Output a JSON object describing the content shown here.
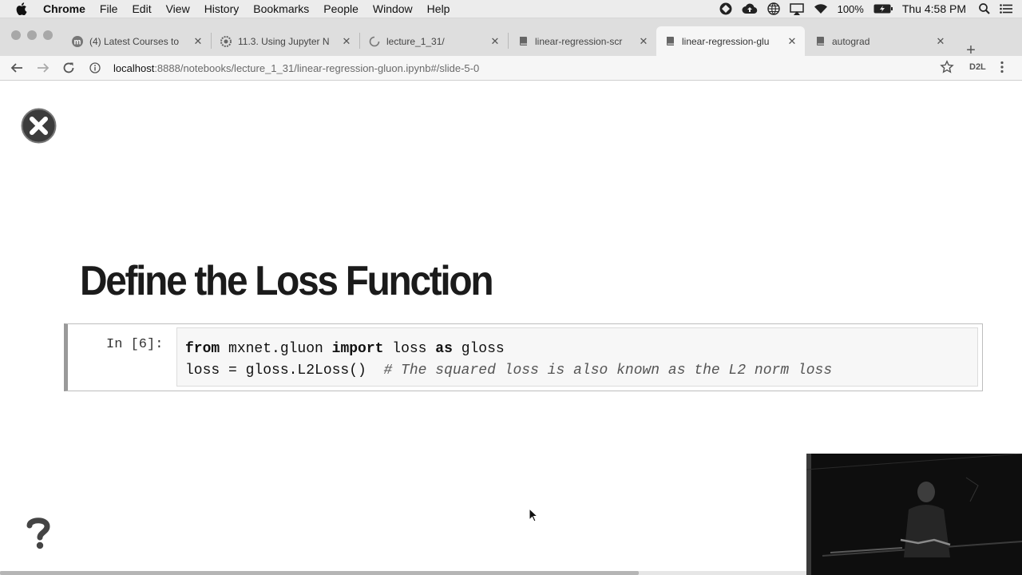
{
  "menubar": {
    "app_name": "Chrome",
    "items": [
      "File",
      "Edit",
      "View",
      "History",
      "Bookmarks",
      "People",
      "Window",
      "Help"
    ],
    "battery": "100%",
    "clock": "Thu 4:58 PM"
  },
  "tabs": [
    {
      "title": "(4) Latest Courses to",
      "icon": "m-logo-icon"
    },
    {
      "title": "11.3. Using Jupyter N",
      "icon": "gear-logo-icon"
    },
    {
      "title": "lecture_1_31/",
      "icon": "loading-spinner-icon"
    },
    {
      "title": "linear-regression-scr",
      "icon": "notebook-icon"
    },
    {
      "title": "linear-regression-glu",
      "icon": "notebook-icon",
      "active": true
    },
    {
      "title": "autograd",
      "icon": "notebook-icon"
    }
  ],
  "address": {
    "host": "localhost",
    "path": ":8888/notebooks/lecture_1_31/linear-regression-gluon.ipynb#/slide-5-0"
  },
  "toolbar": {
    "extension_label": "D2L"
  },
  "slide": {
    "title": "Define the Loss Function",
    "cell": {
      "prompt": "In [6]:",
      "line1": {
        "kw1": "from",
        "t1": " mxnet.gluon ",
        "kw2": "import",
        "t2": " loss ",
        "kw3": "as",
        "t3": " gloss"
      },
      "line2": {
        "code": "loss = gloss.L2Loss()  ",
        "comment": "# The squared loss is also known as the L2 norm loss"
      }
    }
  },
  "colors": {
    "tab_strip": "#dedede",
    "active_tab": "#f6f6f6",
    "cell_border": "#9a9a9a",
    "code_bg": "#f7f7f7"
  }
}
